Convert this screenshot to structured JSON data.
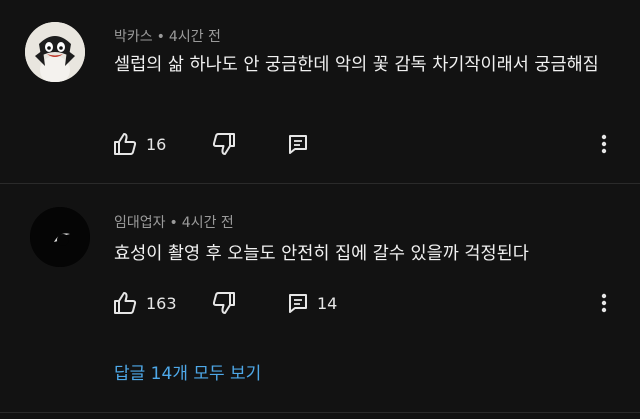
{
  "comments": [
    {
      "author": "박카스",
      "separator": "•",
      "time": "4시간 전",
      "text": "셀럽의 삶 하나도 안 궁금한데 악의 꽃 감독 차기작이래서 궁금해짐",
      "likes": "16",
      "reply_count": "",
      "avatar_icon": "penguin-avatar",
      "avatar_color": "#e9e6df"
    },
    {
      "author": "임대업자",
      "separator": "•",
      "time": "4시간 전",
      "text": "효성이 촬영 후 오늘도 안전히 집에 갈수 있을까 걱정된다",
      "likes": "163",
      "reply_count": "14",
      "avatar_icon": "eclipse-avatar",
      "avatar_color": "#050505",
      "replies_link": "답글 14개 모두 보기"
    }
  ],
  "colors": {
    "background": "#121212",
    "text": "#f1f1f1",
    "meta": "#9a9a9a",
    "link": "#4ea8e8"
  },
  "icons": [
    "thumbs-up-icon",
    "thumbs-down-icon",
    "reply-icon",
    "more-vert-icon"
  ]
}
